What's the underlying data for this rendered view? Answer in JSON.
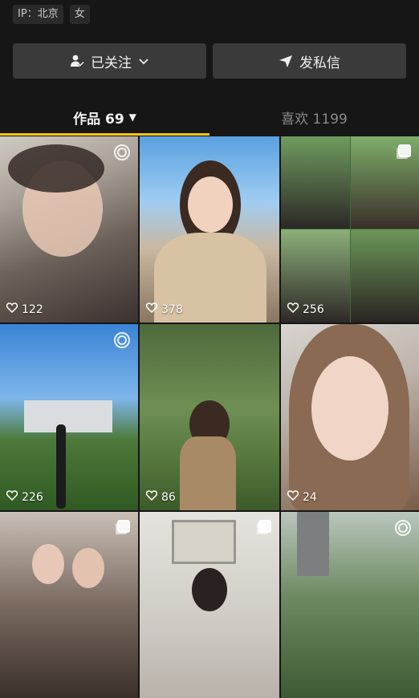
{
  "profile": {
    "tags": [
      {
        "label": "IP：北京"
      },
      {
        "label": "女"
      }
    ]
  },
  "actions": {
    "follow_label": "已关注",
    "message_label": "发私信"
  },
  "tabs": {
    "works_label": "作品 69",
    "likes_label": "喜欢 1199"
  },
  "accent_color": "#f5c518",
  "posts": [
    {
      "likes": "122",
      "badge": "live-icon"
    },
    {
      "likes": "378",
      "badge": ""
    },
    {
      "likes": "256",
      "badge": "multi-image-icon"
    },
    {
      "likes": "226",
      "badge": "live-icon"
    },
    {
      "likes": "86",
      "badge": ""
    },
    {
      "likes": "24",
      "badge": ""
    },
    {
      "likes": "",
      "badge": "multi-image-icon"
    },
    {
      "likes": "",
      "badge": "multi-image-icon"
    },
    {
      "likes": "",
      "badge": "live-icon"
    }
  ]
}
